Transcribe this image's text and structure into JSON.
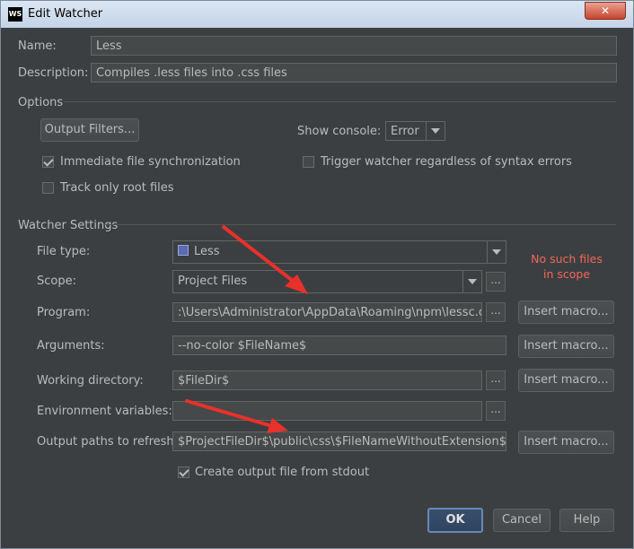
{
  "window": {
    "title": "Edit Watcher",
    "logo": "WS",
    "close_glyph": "✕"
  },
  "name": {
    "label": "Name:",
    "value": "Less"
  },
  "description": {
    "label": "Description:",
    "value": "Compiles .less files into .css files"
  },
  "options": {
    "section_title": "Options",
    "output_filters_label": "Output Filters...",
    "show_console_label": "Show console:",
    "show_console_value": "Error",
    "immediate_sync": {
      "label": "Immediate file synchronization",
      "checked": true
    },
    "trigger_watcher": {
      "label": "Trigger watcher regardless of syntax errors",
      "checked": false
    },
    "track_root": {
      "label": "Track only root files",
      "checked": false
    }
  },
  "watcher_settings": {
    "section_title": "Watcher Settings",
    "file_type": {
      "label": "File type:",
      "value": "Less",
      "icon": "less-file-icon"
    },
    "scope": {
      "label": "Scope:",
      "value": "Project Files"
    },
    "scope_warning": "No such files in scope",
    "program": {
      "label": "Program:",
      "value": ":\\Users\\Administrator\\AppData\\Roaming\\npm\\lessc.cmd"
    },
    "arguments": {
      "label": "Arguments:",
      "value": "--no-color $FileName$"
    },
    "working_dir": {
      "label": "Working directory:",
      "value": "$FileDir$"
    },
    "env_vars": {
      "label": "Environment variables:",
      "value": ""
    },
    "output_paths": {
      "label": "Output paths to refresh:",
      "value": "$ProjectFileDir$\\public\\css\\$FileNameWithoutExtension$.css"
    },
    "create_output": {
      "label": "Create output file from stdout",
      "checked": true
    },
    "insert_macro_label": "Insert macro...",
    "browse_label": "..."
  },
  "footer": {
    "ok_label": "OK",
    "cancel_label": "Cancel",
    "help_label": "Help"
  },
  "annotation_color": "#e8312a"
}
